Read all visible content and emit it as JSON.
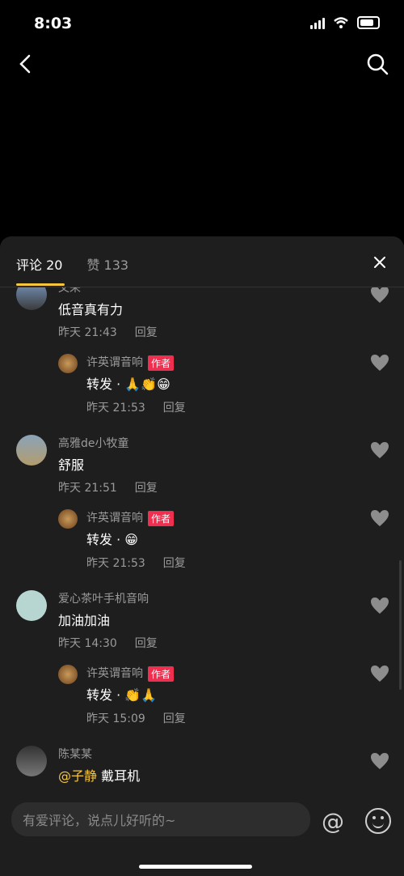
{
  "status": {
    "time": "8:03"
  },
  "tabs": {
    "comments": "评论 20",
    "likes": "赞 133"
  },
  "input": {
    "placeholder": "有爱评论，说点儿好听的~"
  },
  "comments": [
    {
      "name": "文来",
      "text": "低音真有力",
      "time": "昨天 21:43",
      "reply": "回复"
    },
    {
      "name": "许英谓音响",
      "badge": "作者",
      "text": "转发 · 🙏👏😁",
      "time": "昨天 21:53",
      "reply": "回复"
    },
    {
      "name": "高雅de小牧童",
      "text": "舒服",
      "time": "昨天 21:51",
      "reply": "回复"
    },
    {
      "name": "许英谓音响",
      "badge": "作者",
      "text": "转发 · 😁",
      "time": "昨天 21:53",
      "reply": "回复"
    },
    {
      "name": "爱心茶叶手机音响",
      "text": "加油加油",
      "time": "昨天 14:30",
      "reply": "回复"
    },
    {
      "name": "许英谓音响",
      "badge": "作者",
      "text": "转发 · 👏🙏",
      "time": "昨天 15:09",
      "reply": "回复"
    },
    {
      "name": "陈某某",
      "mention": "@子静",
      "text": "戴耳机"
    }
  ],
  "icons": [
    "back-icon",
    "search-icon",
    "close-icon",
    "heart-icon",
    "at-icon",
    "emoji-icon"
  ],
  "colors": {
    "accent": "#f7c641",
    "badge": "#ee2f4f",
    "sheet": "#1e1e1e"
  }
}
